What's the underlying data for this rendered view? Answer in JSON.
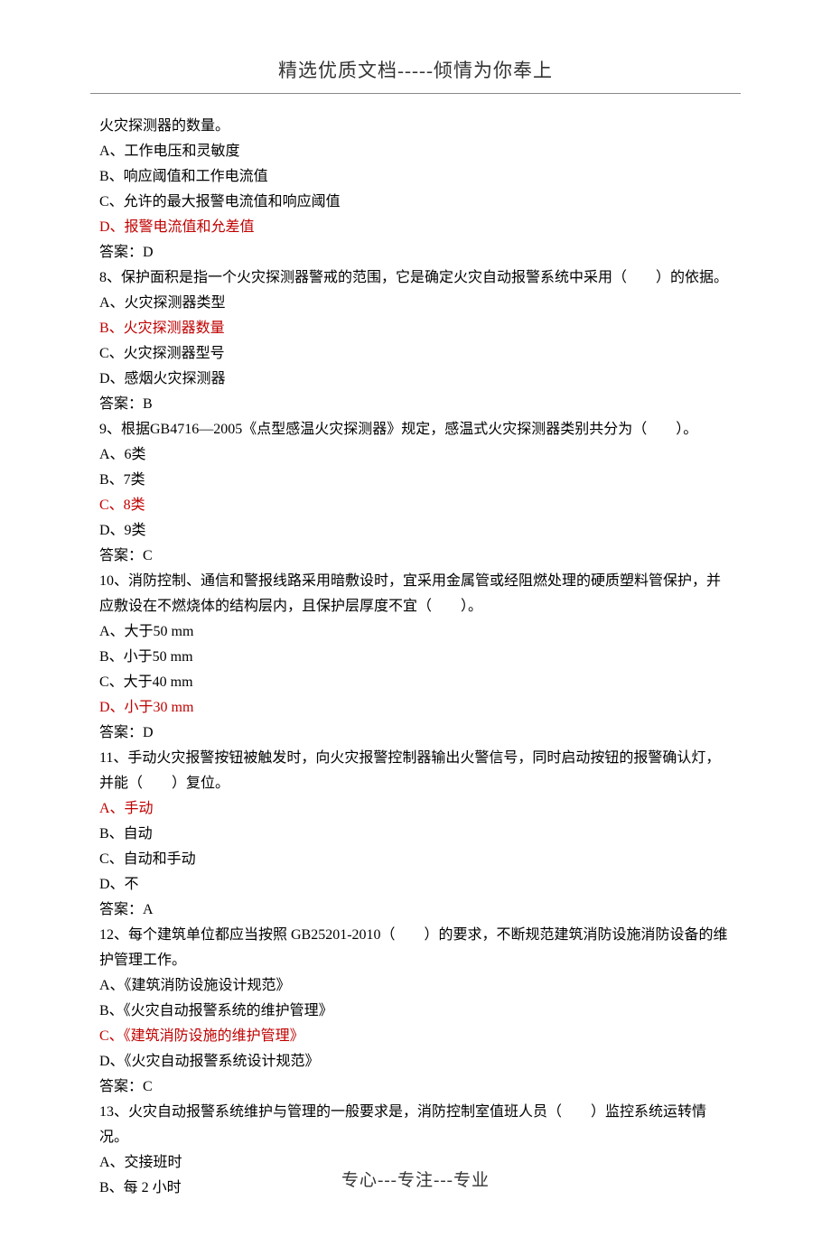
{
  "header": "精选优质文档-----倾情为你奉上",
  "footer": "专心---专注---专业",
  "lines": [
    {
      "text": "火灾探测器的数量。",
      "red": false
    },
    {
      "text": "A、工作电压和灵敏度",
      "red": false
    },
    {
      "text": "B、响应阈值和工作电流值",
      "red": false
    },
    {
      "text": "C、允许的最大报警电流值和响应阈值",
      "red": false
    },
    {
      "text": "D、报警电流值和允差值",
      "red": true
    },
    {
      "text": "答案：D",
      "red": false
    },
    {
      "text": "8、保护面积是指一个火灾探测器警戒的范围，它是确定火灾自动报警系统中采用（　　）的依据。",
      "red": false
    },
    {
      "text": "A、火灾探测器类型",
      "red": false
    },
    {
      "text": "B、火灾探测器数量",
      "red": true
    },
    {
      "text": "C、火灾探测器型号",
      "red": false
    },
    {
      "text": "D、感烟火灾探测器",
      "red": false
    },
    {
      "text": "答案：B",
      "red": false
    },
    {
      "text": "9、根据GB4716—2005《点型感温火灾探测器》规定，感温式火灾探测器类别共分为（　　）。",
      "red": false
    },
    {
      "text": "A、6类",
      "red": false
    },
    {
      "text": "B、7类",
      "red": false
    },
    {
      "text": "C、8类",
      "red": true
    },
    {
      "text": "D、9类",
      "red": false
    },
    {
      "text": "答案：C",
      "red": false
    },
    {
      "text": "10、消防控制、通信和警报线路采用暗敷设时，宜采用金属管或经阻燃处理的硬质塑料管保护，并应敷设在不燃烧体的结构层内，且保护层厚度不宜（　　）。",
      "red": false
    },
    {
      "text": "A、大于50 mm",
      "red": false
    },
    {
      "text": "B、小于50 mm",
      "red": false
    },
    {
      "text": "C、大于40 mm",
      "red": false
    },
    {
      "text": "D、小于30 mm",
      "red": true
    },
    {
      "text": "答案：D",
      "red": false
    },
    {
      "text": "11、手动火灾报警按钮被触发时，向火灾报警控制器输出火警信号，同时启动按钮的报警确认灯，并能（　　）复位。",
      "red": false
    },
    {
      "text": "A、手动",
      "red": true
    },
    {
      "text": "B、自动",
      "red": false
    },
    {
      "text": "C、自动和手动",
      "red": false
    },
    {
      "text": "D、不",
      "red": false
    },
    {
      "text": "答案：A",
      "red": false
    },
    {
      "text": "12、每个建筑单位都应当按照 GB25201-2010（　　）的要求，不断规范建筑消防设施消防设备的维护管理工作。",
      "red": false
    },
    {
      "text": "A、《建筑消防设施设计规范》",
      "red": false
    },
    {
      "text": "B、《火灾自动报警系统的维护管理》",
      "red": false
    },
    {
      "text": "C、《建筑消防设施的维护管理》",
      "red": true
    },
    {
      "text": "D、《火灾自动报警系统设计规范》",
      "red": false
    },
    {
      "text": "答案：C",
      "red": false
    },
    {
      "text": "13、火灾自动报警系统维护与管理的一般要求是，消防控制室值班人员（　　）监控系统运转情况。",
      "red": false
    },
    {
      "text": "A、交接班时",
      "red": false
    },
    {
      "text": "B、每 2 小时",
      "red": false
    }
  ]
}
